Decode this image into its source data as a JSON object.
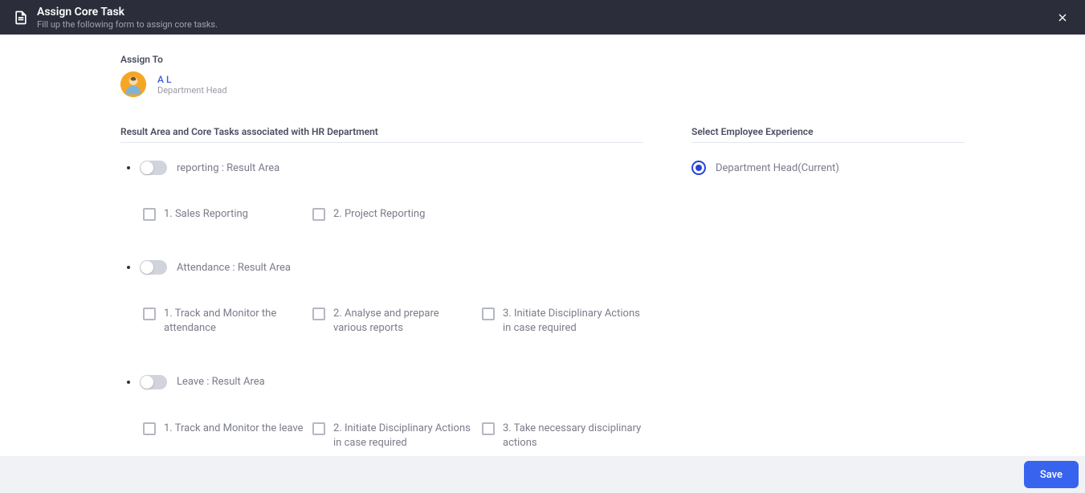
{
  "header": {
    "title": "Assign Core Task",
    "subtitle": "Fill up the following form to assign core tasks."
  },
  "assignTo": {
    "label": "Assign To",
    "name": "A L",
    "role": "Department Head"
  },
  "leftSection": {
    "header": "Result Area and Core Tasks associated with HR Department",
    "areas": [
      {
        "label": "reporting : Result Area",
        "tasks": [
          "1. Sales Reporting",
          "2. Project Reporting"
        ]
      },
      {
        "label": "Attendance : Result Area",
        "tasks": [
          "1. Track and Monitor the attendance",
          "2. Analyse and prepare various reports",
          "3. Initiate Disciplinary Actions in case required"
        ]
      },
      {
        "label": "Leave : Result Area",
        "tasks": [
          "1. Track and Monitor the leave",
          "2. Initiate Disciplinary Actions in case required",
          "3. Take necessary disciplinary actions"
        ]
      }
    ]
  },
  "rightSection": {
    "header": "Select Employee Experience",
    "options": [
      {
        "label": "Department Head(Current)",
        "selected": true
      }
    ]
  },
  "footer": {
    "saveLabel": "Save"
  }
}
